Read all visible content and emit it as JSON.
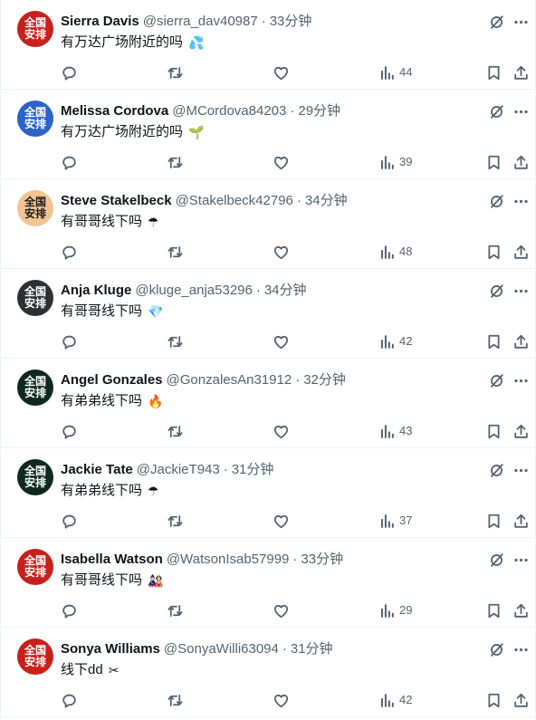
{
  "colors": {
    "text_primary": "#0f1419",
    "text_secondary": "#536471",
    "divider": "#eff3f4",
    "avatar_red": "#c8201c",
    "avatar_blue": "#2a63c9",
    "avatar_peach": "#f2c493",
    "avatar_dark": "#2e2f33",
    "avatar_green": "#0f2a1c"
  },
  "icons": {
    "mute": "mute-circle-slash-icon",
    "more": "more-dots-icon",
    "reply": "reply-bubble-icon",
    "retweet": "retweet-icon",
    "like": "heart-icon",
    "views": "views-bar-chart-icon",
    "bookmark": "bookmark-icon",
    "share": "share-upload-icon"
  },
  "tweets": [
    {
      "avatar": {
        "line1": "全国",
        "line2": "安排",
        "color": "#c8201c",
        "text_color": "#ffffff"
      },
      "name": "Sierra Davis",
      "handle": "@sierra_dav40987",
      "separator": "·",
      "time": "33分钟",
      "text": "有万达广场附近的吗",
      "emoji": "💦",
      "views": "44"
    },
    {
      "avatar": {
        "line1": "全国",
        "line2": "安排",
        "color": "#2a63c9",
        "text_color": "#ffffff"
      },
      "name": "Melissa Cordova",
      "handle": "@MCordova84203",
      "separator": "·",
      "time": "29分钟",
      "text": "有万达广场附近的吗",
      "emoji": "🌱",
      "views": "39"
    },
    {
      "avatar": {
        "line1": "全国",
        "line2": "安排",
        "color": "#f2c493",
        "text_color": "#1a1a1a"
      },
      "name": "Steve Stakelbeck",
      "handle": "@Stakelbeck42796",
      "separator": "·",
      "time": "34分钟",
      "text": "有哥哥线下吗",
      "emoji": "☂",
      "views": "48"
    },
    {
      "avatar": {
        "line1": "全国",
        "line2": "安排",
        "color": "#2e2f33",
        "text_color": "#ffffff"
      },
      "name": "Anja Kluge",
      "handle": "@kluge_anja53296",
      "separator": "·",
      "time": "34分钟",
      "text": "有哥哥线下吗",
      "emoji": "💎",
      "views": "42"
    },
    {
      "avatar": {
        "line1": "全国",
        "line2": "安排",
        "color": "#0f2a1c",
        "text_color": "#ffffff"
      },
      "name": "Angel Gonzales",
      "handle": "@GonzalesAn31912",
      "separator": "·",
      "time": "32分钟",
      "text": "有弟弟线下吗",
      "emoji": "🔥",
      "views": "43"
    },
    {
      "avatar": {
        "line1": "全国",
        "line2": "安排",
        "color": "#0f2a1c",
        "text_color": "#ffffff"
      },
      "name": "Jackie Tate",
      "handle": "@JackieT943",
      "separator": "·",
      "time": "31分钟",
      "text": "有弟弟线下吗",
      "emoji": "☂",
      "views": "37"
    },
    {
      "avatar": {
        "line1": "全国",
        "line2": "安排",
        "color": "#c8201c",
        "text_color": "#ffffff"
      },
      "name": "Isabella Watson",
      "handle": "@WatsonIsab57999",
      "separator": "·",
      "time": "33分钟",
      "text": "有哥哥线下吗",
      "emoji": "🎎",
      "views": "29"
    },
    {
      "avatar": {
        "line1": "全国",
        "line2": "安排",
        "color": "#c8201c",
        "text_color": "#ffffff"
      },
      "name": "Sonya Williams",
      "handle": "@SonyaWilli63094",
      "separator": "·",
      "time": "31分钟",
      "text": "线下dd",
      "emoji": "✂",
      "views": "42"
    }
  ]
}
